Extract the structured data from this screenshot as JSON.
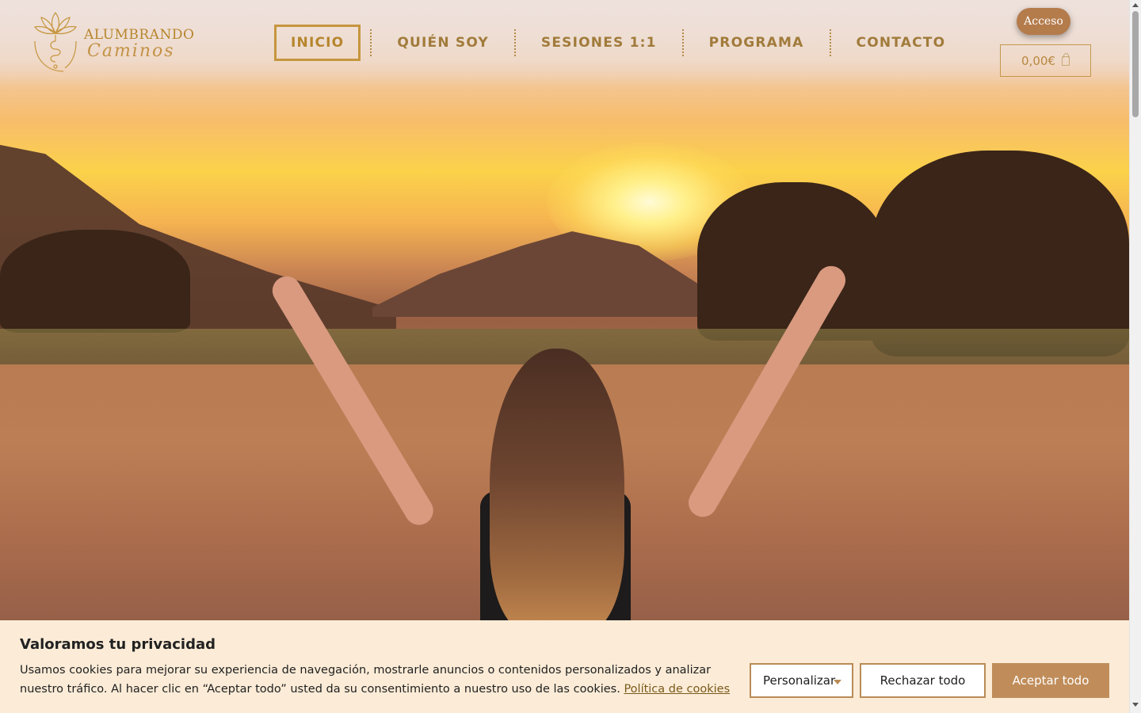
{
  "brand": {
    "title": "ALUMBRANDO",
    "subtitle": "Caminos"
  },
  "nav": {
    "items": [
      {
        "label": "INICIO"
      },
      {
        "label": "QUIÉN SOY"
      },
      {
        "label": "SESIONES 1:1"
      },
      {
        "label": "PROGRAMA"
      },
      {
        "label": "CONTACTO"
      }
    ]
  },
  "header": {
    "acceso_label": "Acceso",
    "cart_total": "0,00€",
    "cart_icon": "shopping-bag-icon"
  },
  "cookie_banner": {
    "title": "Valoramos tu privacidad",
    "text": "Usamos cookies para mejorar su experiencia de navegación, mostrarle anuncios o contenidos personalizados y analizar nuestro tráfico. Al hacer clic en “Aceptar todo” usted da su consentimiento a nuestro uso de las cookies.",
    "policy_link": "Política de cookies",
    "customize_label": "Personalizar",
    "reject_label": "Rechazar todo",
    "accept_label": "Aceptar todo"
  },
  "colors": {
    "accent_gold": "#b6862c",
    "cookie_bg": "#fcecd7",
    "accept_bg": "#c08d5a"
  }
}
